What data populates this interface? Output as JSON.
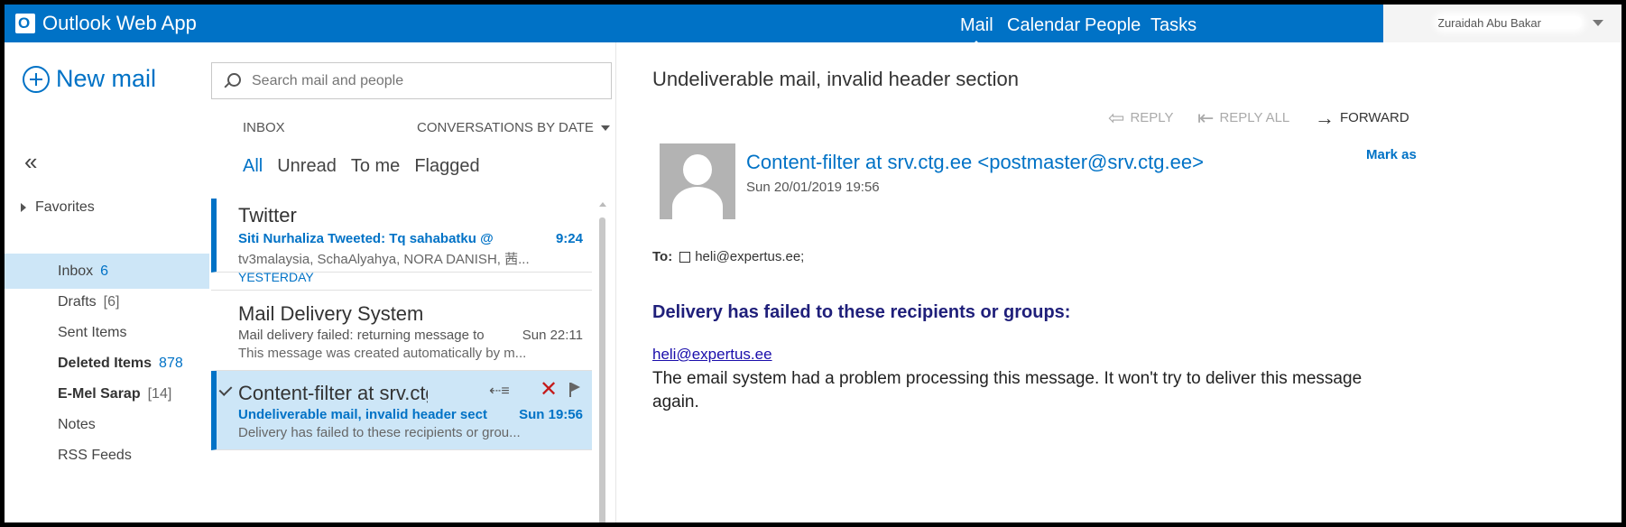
{
  "app": {
    "title": "Outlook Web App",
    "logo_letter": "O",
    "brand_color": "#0072c6",
    "selected_color": "#cde6f7"
  },
  "topnav": {
    "items": [
      {
        "label": "Mail",
        "active": true
      },
      {
        "label": "Calendar",
        "active": false
      },
      {
        "label": "People",
        "active": false
      },
      {
        "label": "Tasks",
        "active": false
      }
    ],
    "user_name": "Zuraidah Abu Bakar"
  },
  "leftnav": {
    "new_mail": "New mail",
    "collapse_glyph": "«",
    "favorites": "Favorites",
    "folders": [
      {
        "name": "Inbox",
        "count": "6",
        "bold": false,
        "selected": true
      },
      {
        "name": "Drafts",
        "count": "[6]",
        "bold": false,
        "selected": false
      },
      {
        "name": "Sent Items",
        "count": "",
        "bold": false,
        "selected": false
      },
      {
        "name": "Deleted Items",
        "count": "878",
        "bold": true,
        "selected": false
      },
      {
        "name": "E-Mel Sarap",
        "count": "[14]",
        "bold": true,
        "selected": false
      },
      {
        "name": "Notes",
        "count": "",
        "bold": false,
        "selected": false
      },
      {
        "name": "RSS Feeds",
        "count": "",
        "bold": false,
        "selected": false
      }
    ]
  },
  "search": {
    "placeholder": "Search mail and people"
  },
  "list": {
    "folder_label": "INBOX",
    "sort_label": "CONVERSATIONS BY DATE",
    "filters": [
      "All",
      "Unread",
      "To me",
      "Flagged"
    ],
    "group_yesterday": "YESTERDAY",
    "messages": [
      {
        "from": "Twitter",
        "subject": "Siti Nurhaliza Tweeted: Tq sahabatku @",
        "time": "9:24",
        "preview": "tv3malaysia, SchaAlyahya, NORA DANISH, 茜..."
      },
      {
        "from": "Mail Delivery System",
        "subject": "Mail delivery failed: returning message to",
        "time": "Sun 22:11",
        "preview": "This message was created automatically by m..."
      },
      {
        "from": "Content-filter at srv.ctg.ee",
        "subject": "Undeliverable mail, invalid header section",
        "time": "Sun 19:56",
        "preview": "Delivery has failed to these recipients or grou..."
      }
    ],
    "delete_glyph": "✕",
    "reply_glyph": "⇠≡"
  },
  "reading": {
    "subject": "Undeliverable mail, invalid header section",
    "actions": {
      "reply": "REPLY",
      "reply_all": "REPLY ALL",
      "forward": "FORWARD"
    },
    "sender": "Content-filter at srv.ctg.ee <postmaster@srv.ctg.ee>",
    "date": "Sun 20/01/2019 19:56",
    "mark_as": "Mark as",
    "to_label": "To:",
    "to_value": "heli@expertus.ee;",
    "body_heading": "Delivery has failed to these recipients or groups:",
    "body_link": "heli@expertus.ee",
    "body_line1": "The email system had a problem processing this message. It won't try to deliver this message",
    "body_line2": "again."
  }
}
